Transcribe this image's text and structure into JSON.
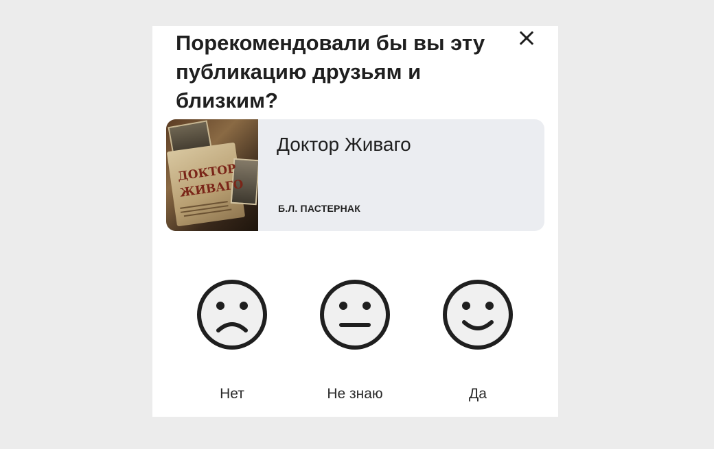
{
  "dialog": {
    "question": "Порекомендовали бы вы эту публикацию друзьям и близким?",
    "close_icon": "close-icon"
  },
  "book": {
    "title": "Доктор Живаго",
    "author": "Б.Л. ПАСТЕРНАК",
    "cover_title": "ДОКТОР ЖИВАГО"
  },
  "ratings": [
    {
      "label": "Нет",
      "icon": "sad-face-icon"
    },
    {
      "label": "Не знаю",
      "icon": "neutral-face-icon"
    },
    {
      "label": "Да",
      "icon": "happy-face-icon"
    }
  ],
  "colors": {
    "background": "#ececec",
    "dialog": "#ffffff",
    "card": "#ebedf1",
    "face_fill": "#f0f0f0",
    "stroke": "#1f1f1f"
  }
}
